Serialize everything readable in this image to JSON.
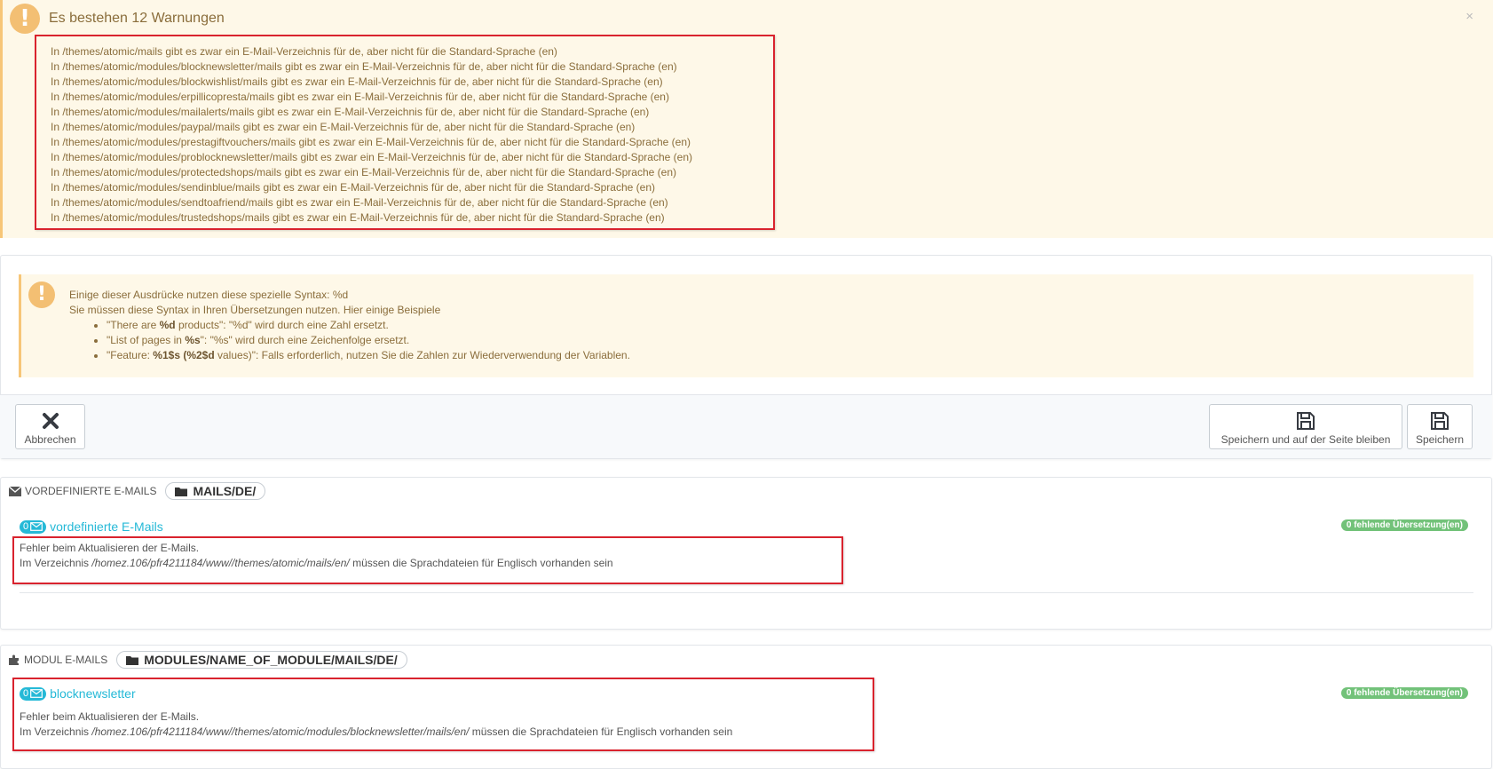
{
  "warning": {
    "title": "Es bestehen 12 Warnungen",
    "close": "×",
    "items": [
      "In /themes/atomic/mails gibt es zwar ein E-Mail-Verzeichnis für de, aber nicht für die Standard-Sprache (en)",
      "In /themes/atomic/modules/blocknewsletter/mails gibt es zwar ein E-Mail-Verzeichnis für de, aber nicht für die Standard-Sprache (en)",
      "In /themes/atomic/modules/blockwishlist/mails gibt es zwar ein E-Mail-Verzeichnis für de, aber nicht für die Standard-Sprache (en)",
      "In /themes/atomic/modules/erpillicopresta/mails gibt es zwar ein E-Mail-Verzeichnis für de, aber nicht für die Standard-Sprache (en)",
      "In /themes/atomic/modules/mailalerts/mails gibt es zwar ein E-Mail-Verzeichnis für de, aber nicht für die Standard-Sprache (en)",
      "In /themes/atomic/modules/paypal/mails gibt es zwar ein E-Mail-Verzeichnis für de, aber nicht für die Standard-Sprache (en)",
      "In /themes/atomic/modules/prestagiftvouchers/mails gibt es zwar ein E-Mail-Verzeichnis für de, aber nicht für die Standard-Sprache (en)",
      "In /themes/atomic/modules/problocknewsletter/mails gibt es zwar ein E-Mail-Verzeichnis für de, aber nicht für die Standard-Sprache (en)",
      "In /themes/atomic/modules/protectedshops/mails gibt es zwar ein E-Mail-Verzeichnis für de, aber nicht für die Standard-Sprache (en)",
      "In /themes/atomic/modules/sendinblue/mails gibt es zwar ein E-Mail-Verzeichnis für de, aber nicht für die Standard-Sprache (en)",
      "In /themes/atomic/modules/sendtoafriend/mails gibt es zwar ein E-Mail-Verzeichnis für de, aber nicht für die Standard-Sprache (en)",
      "In /themes/atomic/modules/trustedshops/mails gibt es zwar ein E-Mail-Verzeichnis für de, aber nicht für die Standard-Sprache (en)"
    ]
  },
  "info": {
    "line1": "Einige dieser Ausdrücke nutzen diese spezielle Syntax: %d",
    "line2": "Sie müssen diese Syntax in Ihren Übersetzungen nutzen. Hier einige Beispiele",
    "ex1": {
      "a": "\"There are ",
      "b": "%d",
      "c": " products\": \"%d\" wird durch eine Zahl ersetzt."
    },
    "ex2": {
      "a": "\"List of pages in ",
      "b": "%s",
      "c": "\": \"%s\" wird durch eine Zeichenfolge ersetzt."
    },
    "ex3": {
      "a": "\"Feature: ",
      "b": "%1$s (%2$d",
      "c": " values)\": Falls erforderlich, nutzen Sie die Zahlen zur Wiederverwendung der Variablen."
    }
  },
  "toolbar": {
    "cancel_label": "Abbrechen",
    "save_stay_label": "Speichern und auf der Seite bleiben",
    "save_label": "Speichern"
  },
  "predefined": {
    "heading": "VORDEFINIERTE E-MAILS",
    "path": "MAILS/DE/",
    "count": "0",
    "link": "vordefinierte E-Mails",
    "missing": "0 fehlende Übersetzung(en)",
    "err1": "Fehler beim Aktualisieren der E-Mails.",
    "err2a": "Im Verzeichnis ",
    "err2b": "/homez.106/pfr4211184/www//themes/atomic/mails/en/",
    "err2c": " müssen die Sprachdateien für Englisch vorhanden sein"
  },
  "module": {
    "heading": "MODUL E-MAILS",
    "path": "MODULES/NAME_OF_MODULE/MAILS/DE/",
    "count": "0",
    "link": "blocknewsletter",
    "missing": "0 fehlende Übersetzung(en)",
    "err1": "Fehler beim Aktualisieren der E-Mails.",
    "err2a": "Im Verzeichnis ",
    "err2b": "/homez.106/pfr4211184/www//themes/atomic/modules/blocknewsletter/mails/en/",
    "err2c": " müssen die Sprachdateien für Englisch vorhanden sein"
  },
  "colors": {
    "accent": "#25b9d7",
    "success": "#72c279",
    "warning_bg": "#fef8e8",
    "highlight": "#d9232e"
  }
}
